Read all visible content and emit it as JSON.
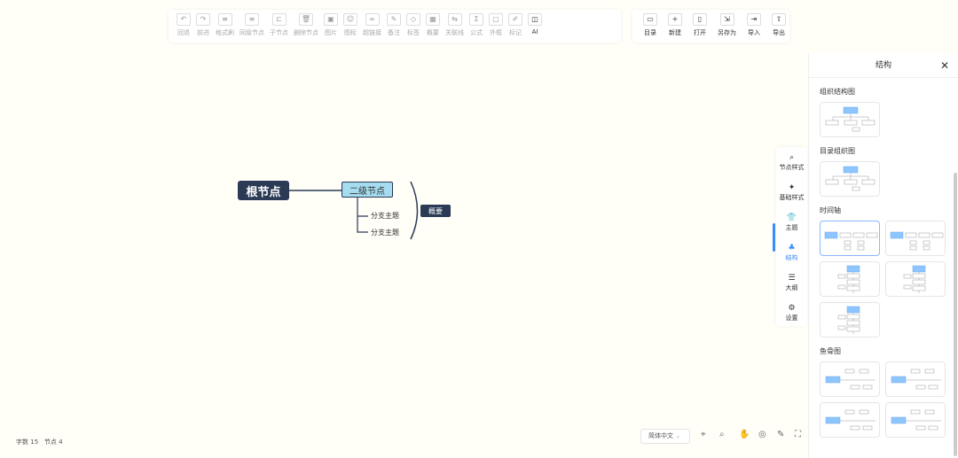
{
  "toolbar": {
    "items": [
      {
        "icon": "↶",
        "label": "回退"
      },
      {
        "icon": "↷",
        "label": "前进"
      },
      {
        "icon": "≡",
        "label": "格式刷"
      },
      {
        "icon": "≡",
        "label": "同级节点"
      },
      {
        "icon": "⊏",
        "label": "子节点"
      },
      {
        "icon": "🗑",
        "label": "删除节点"
      },
      {
        "icon": "▣",
        "label": "图片"
      },
      {
        "icon": "☺",
        "label": "图标"
      },
      {
        "icon": "∞",
        "label": "超链接"
      },
      {
        "icon": "✎",
        "label": "备注"
      },
      {
        "icon": "◇",
        "label": "标签"
      },
      {
        "icon": "▦",
        "label": "概要"
      },
      {
        "icon": "⇆",
        "label": "关联线"
      },
      {
        "icon": "Σ",
        "label": "公式"
      },
      {
        "icon": "▢",
        "label": "外框"
      },
      {
        "icon": "✐",
        "label": "标记"
      },
      {
        "icon": "◫",
        "label": "AI"
      }
    ]
  },
  "filebar": {
    "items": [
      {
        "icon": "▭",
        "label": "目录"
      },
      {
        "icon": "+",
        "label": "新建"
      },
      {
        "icon": "▯",
        "label": "打开"
      },
      {
        "icon": "⇲",
        "label": "另存为"
      },
      {
        "icon": "⇥",
        "label": "导入"
      },
      {
        "icon": "⇧",
        "label": "导出"
      }
    ]
  },
  "mindmap": {
    "root": "根节点",
    "second": "二级节点",
    "branches": [
      "分支主题",
      "分支主题"
    ],
    "summary": "概要"
  },
  "panel": {
    "title": "结构",
    "sections": {
      "org": "组织结构图",
      "catalog": "目录组织图",
      "timeline": "时间轴",
      "fishbone": "鱼骨图"
    }
  },
  "tabs": [
    {
      "icon": "⌕",
      "label": "节点样式"
    },
    {
      "icon": "✦",
      "label": "基础样式"
    },
    {
      "icon": "👕",
      "label": "主题"
    },
    {
      "icon": "♣",
      "label": "结构"
    },
    {
      "icon": "☰",
      "label": "大纲"
    },
    {
      "icon": "⚙",
      "label": "设置"
    }
  ],
  "status": {
    "words_label": "字数",
    "words": "15",
    "nodes_label": "节点",
    "nodes": "4"
  },
  "language": "简体中文"
}
